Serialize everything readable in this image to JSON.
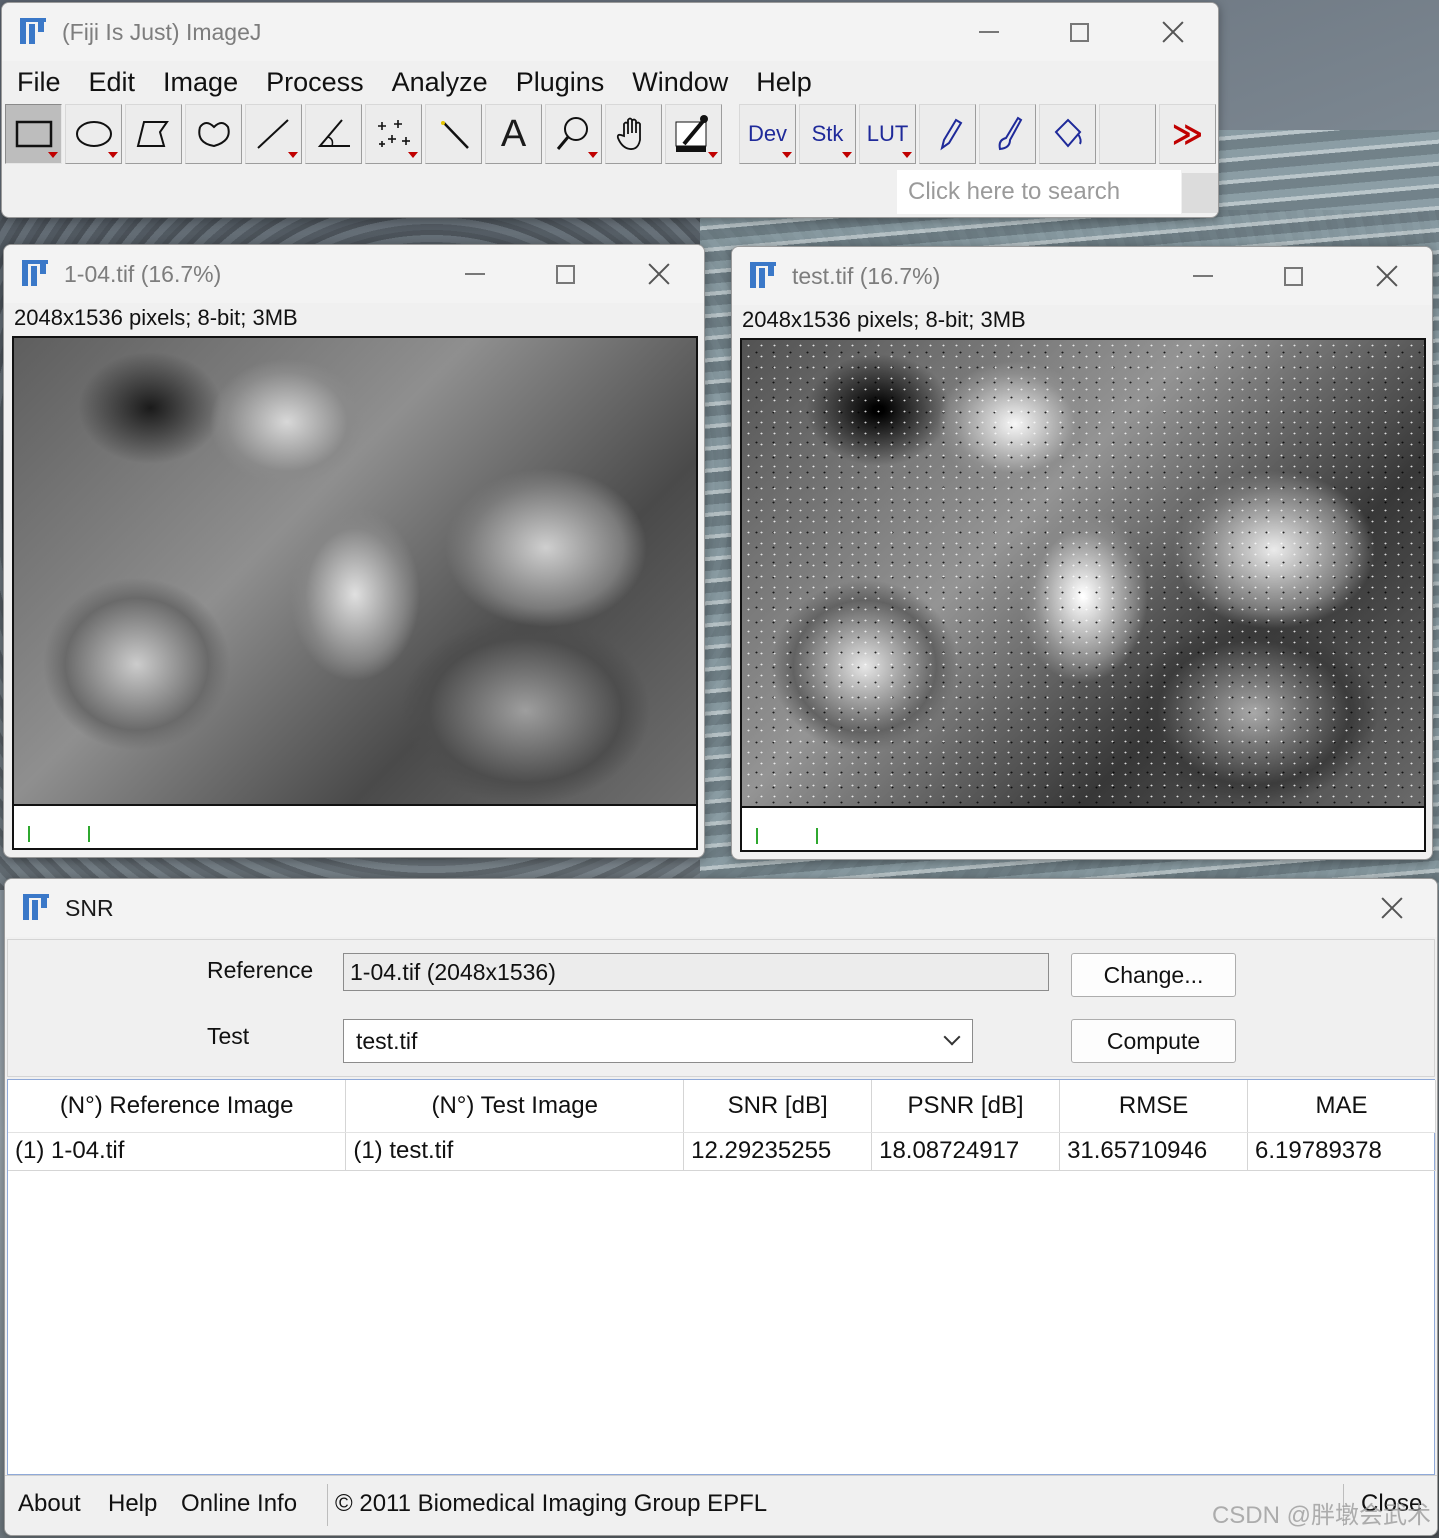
{
  "main_window": {
    "title": "(Fiji Is Just) ImageJ",
    "menus": [
      "File",
      "Edit",
      "Image",
      "Process",
      "Analyze",
      "Plugins",
      "Window",
      "Help"
    ],
    "tools": [
      {
        "name": "rectangle-tool-icon",
        "glyph": ""
      },
      {
        "name": "oval-tool-icon",
        "glyph": ""
      },
      {
        "name": "polygon-tool-icon",
        "glyph": ""
      },
      {
        "name": "freehand-tool-icon",
        "glyph": ""
      },
      {
        "name": "line-tool-icon",
        "glyph": ""
      },
      {
        "name": "angle-tool-icon",
        "glyph": ""
      },
      {
        "name": "point-tool-icon",
        "glyph": ""
      },
      {
        "name": "wand-tool-icon",
        "glyph": ""
      },
      {
        "name": "text-tool-icon",
        "glyph": "A"
      },
      {
        "name": "magnifier-tool-icon",
        "glyph": ""
      },
      {
        "name": "hand-tool-icon",
        "glyph": ""
      },
      {
        "name": "dropper-tool-icon",
        "glyph": ""
      }
    ],
    "extra_tools": {
      "dev": "Dev",
      "stk": "Stk",
      "lut": "LUT"
    },
    "search_placeholder": "Click here to search",
    "more_glyph": "≫"
  },
  "image_windows": [
    {
      "title": "1-04.tif (16.7%)",
      "info": "2048x1536 pixels; 8-bit; 3MB"
    },
    {
      "title": "test.tif (16.7%)",
      "info": "2048x1536 pixels; 8-bit; 3MB"
    }
  ],
  "snr": {
    "title": "SNR",
    "reference_label": "Reference",
    "reference_value": "1-04.tif (2048x1536)",
    "test_label": "Test",
    "test_value": "test.tif",
    "change_button": "Change...",
    "compute_button": "Compute",
    "columns": [
      "(N°) Reference Image",
      "(N°) Test Image",
      "SNR [dB]",
      "PSNR [dB]",
      "RMSE",
      "MAE"
    ],
    "rows": [
      [
        "(1) 1-04.tif",
        "(1) test.tif",
        "12.29235255",
        "18.08724917",
        "31.65710946",
        "6.19789378"
      ]
    ],
    "status": {
      "about": "About",
      "help": "Help",
      "online_info": "Online Info",
      "copyright": "© 2011 Biomedical Imaging Group EPFL",
      "close": "Close"
    }
  },
  "watermark": "CSDN @胖墩会武术"
}
